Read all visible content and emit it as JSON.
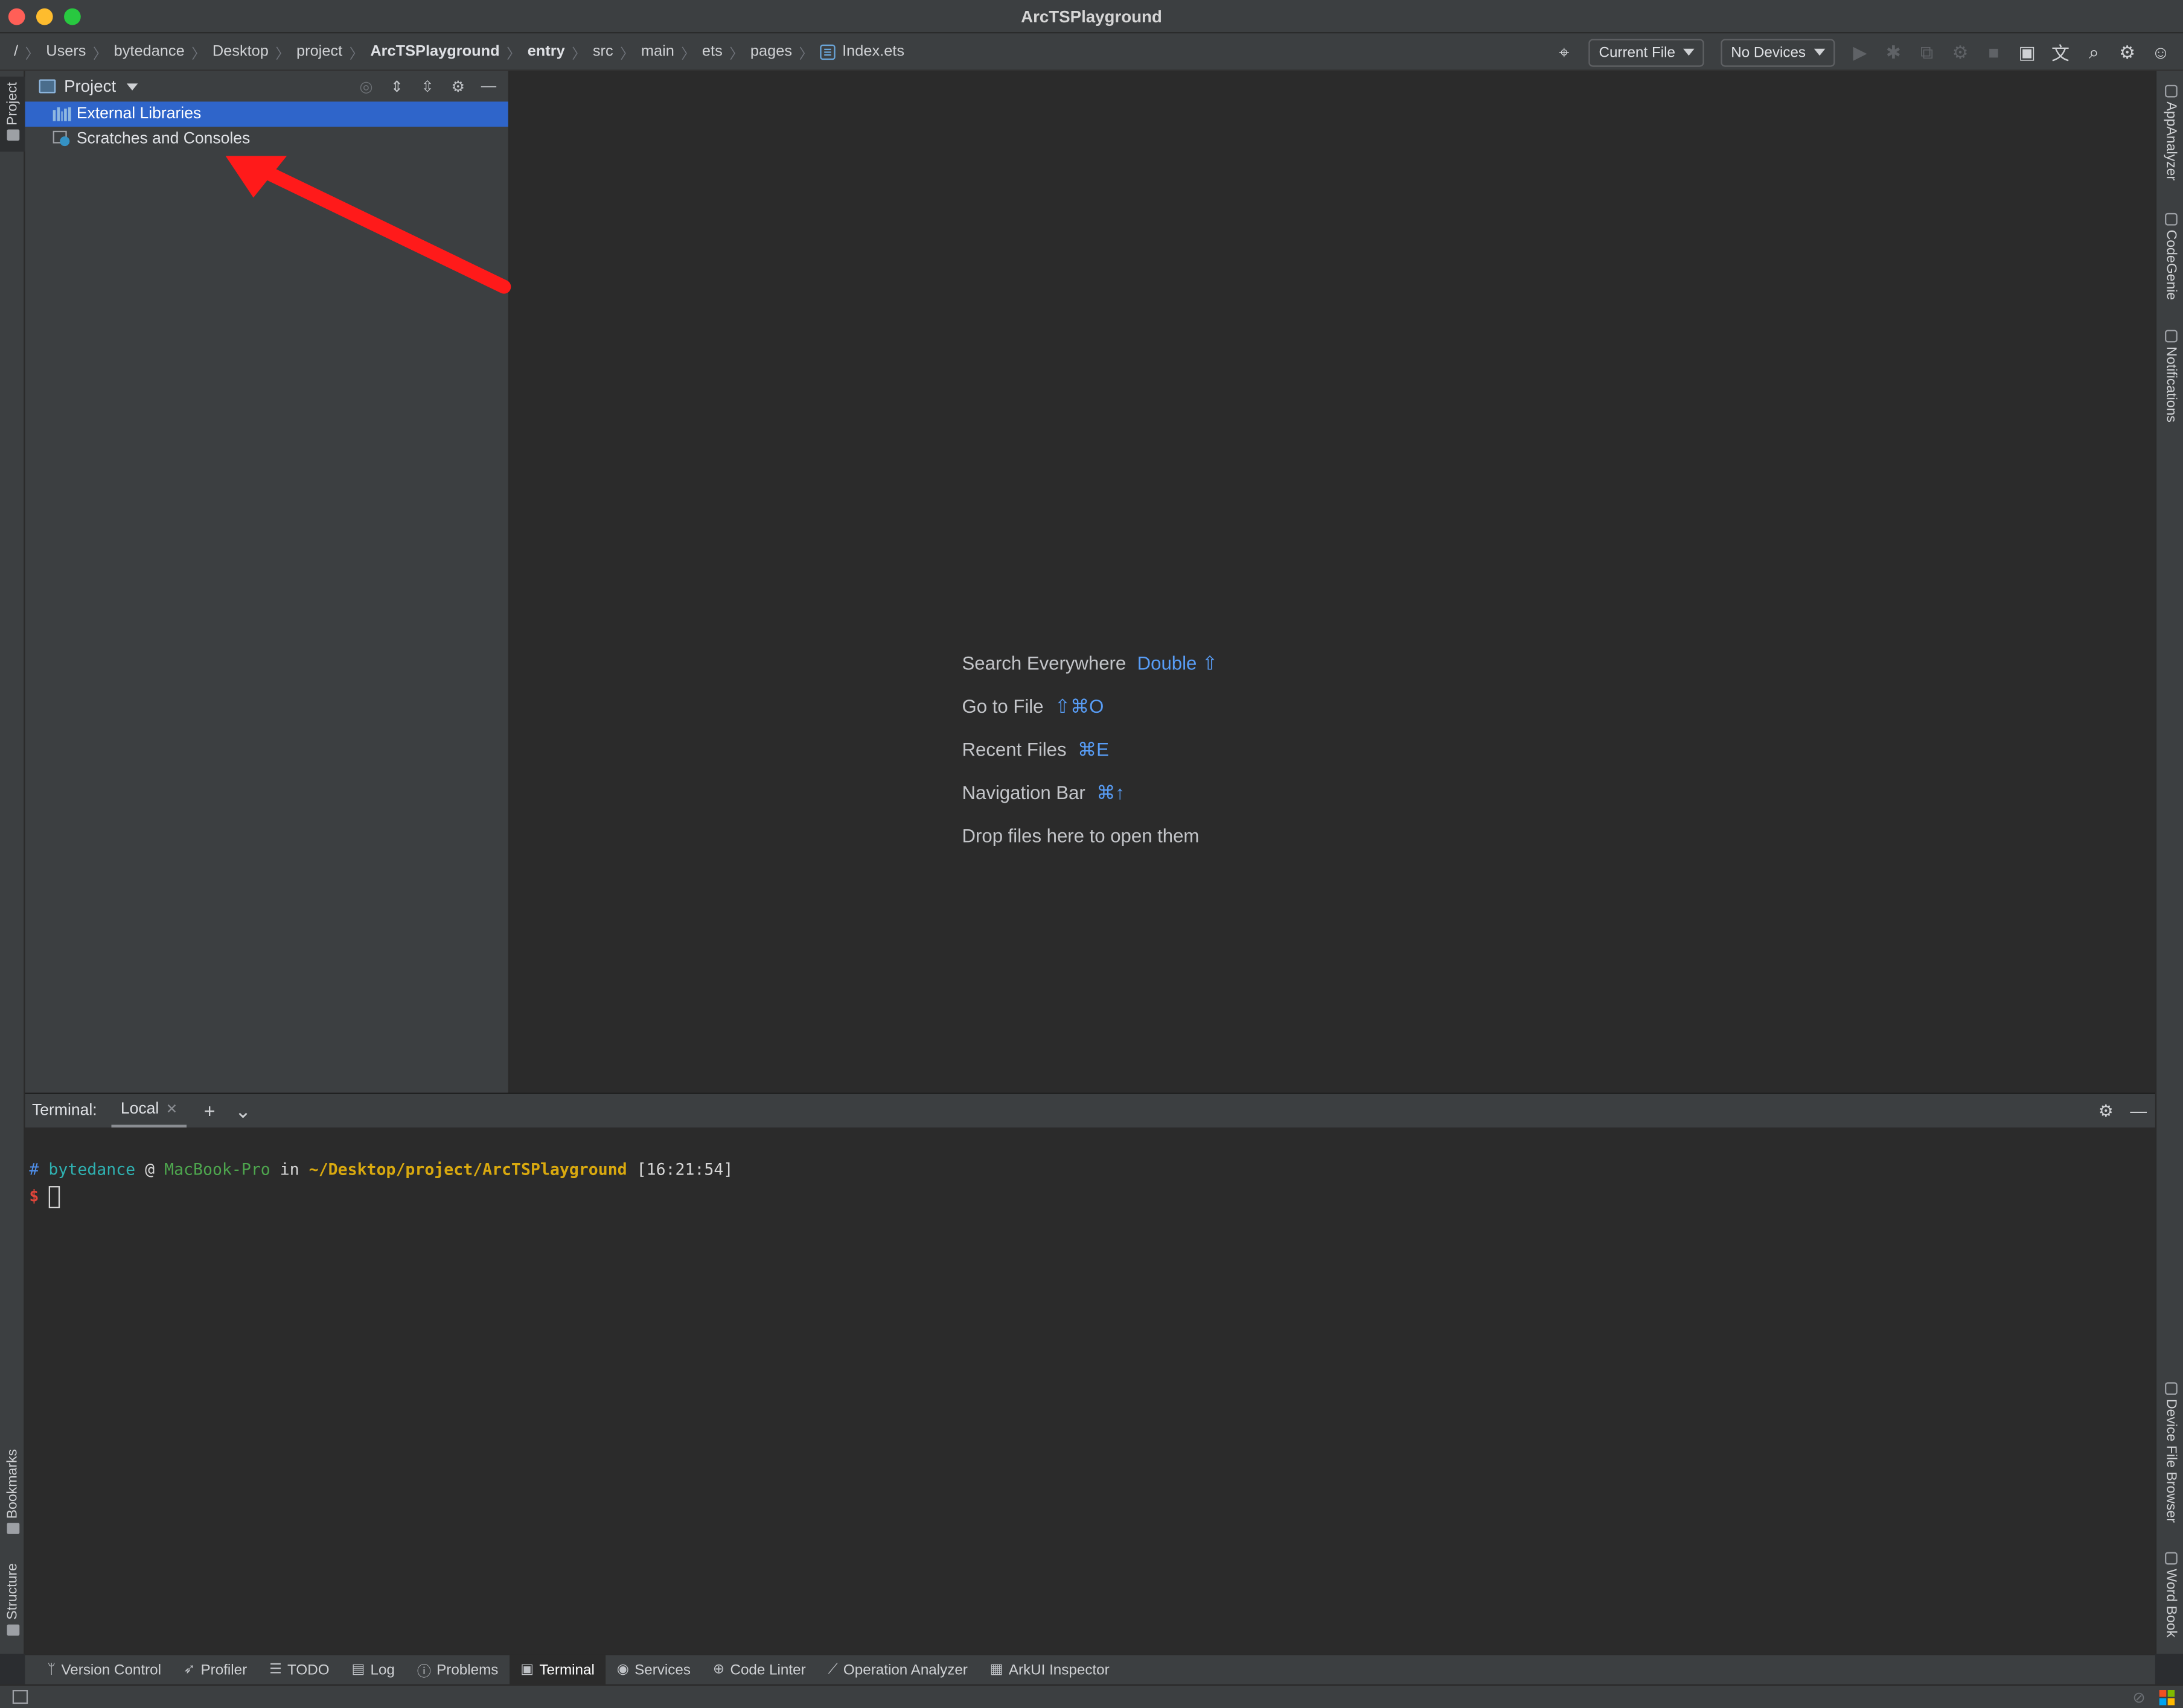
{
  "window": {
    "title": "ArcTSPlayground"
  },
  "breadcrumb": {
    "root": "/",
    "items": [
      "Users",
      "bytedance",
      "Desktop",
      "project",
      "ArcTSPlayground",
      "entry",
      "src",
      "main",
      "ets",
      "pages"
    ],
    "file": "Index.ets"
  },
  "toolbar": {
    "run_config": "Current File",
    "device": "No Devices"
  },
  "left_strip": {
    "project": "Project",
    "bookmarks": "Bookmarks",
    "structure": "Structure"
  },
  "right_strip": {
    "app_analyzer": "AppAnalyzer",
    "code_genie": "CodeGenie",
    "notifications": "Notifications",
    "device_file_browser": "Device File Browser",
    "word_book": "Word Book"
  },
  "project_panel": {
    "title": "Project",
    "tree": [
      {
        "label": "External Libraries",
        "selected": true
      },
      {
        "label": "Scratches and Consoles",
        "selected": false
      }
    ]
  },
  "editor": {
    "hints": [
      {
        "label": "Search Everywhere",
        "key": "Double ⇧"
      },
      {
        "label": "Go to File",
        "key": "⇧⌘O"
      },
      {
        "label": "Recent Files",
        "key": "⌘E"
      },
      {
        "label": "Navigation Bar",
        "key": "⌘↑"
      },
      {
        "label": "Drop files here to open them",
        "key": ""
      }
    ]
  },
  "terminal": {
    "label": "Terminal:",
    "tab": "Local",
    "prompt": {
      "hash": "#",
      "user": "bytedance",
      "at": "@",
      "host": "MacBook-Pro",
      "in": "in",
      "path": "~/Desktop/project/ArcTSPlayground",
      "time": "[16:21:54]",
      "dollar": "$"
    }
  },
  "bottom_tools": [
    {
      "label": "Version Control",
      "icon": "branch-icon",
      "active": false
    },
    {
      "label": "Profiler",
      "icon": "profiler-icon",
      "active": false
    },
    {
      "label": "TODO",
      "icon": "list-icon",
      "active": false
    },
    {
      "label": "Log",
      "icon": "log-icon",
      "active": false
    },
    {
      "label": "Problems",
      "icon": "problems-icon",
      "active": false
    },
    {
      "label": "Terminal",
      "icon": "terminal-icon",
      "active": true
    },
    {
      "label": "Services",
      "icon": "services-icon",
      "active": false
    },
    {
      "label": "Code Linter",
      "icon": "linter-icon",
      "active": false
    },
    {
      "label": "Operation Analyzer",
      "icon": "analyzer-icon",
      "active": false
    },
    {
      "label": "ArkUI Inspector",
      "icon": "inspector-icon",
      "active": false
    }
  ],
  "colors": {
    "selection": "#2f65ca",
    "hint_key": "#589df6",
    "annotation_arrow": "#ff1a1a"
  }
}
